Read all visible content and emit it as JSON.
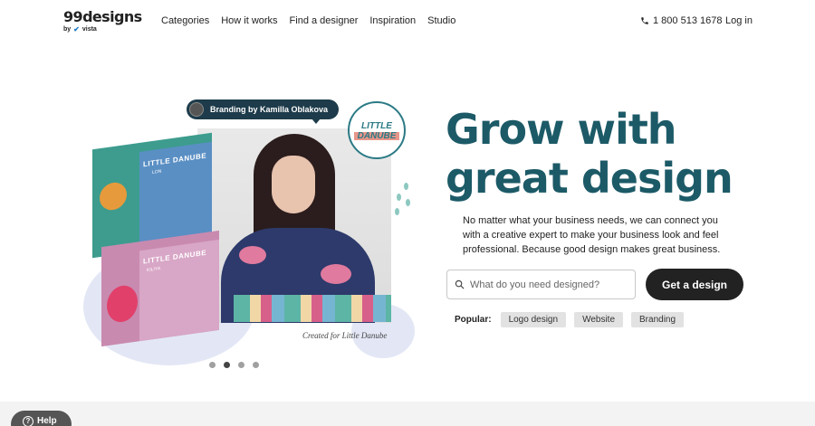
{
  "header": {
    "logo_main": "99designs",
    "logo_by": "by",
    "logo_brand": "vista",
    "nav": [
      "Categories",
      "How it works",
      "Find a designer",
      "Inspiration",
      "Studio"
    ],
    "phone": "1 800 513 1678",
    "login": "Log in"
  },
  "hero": {
    "credit": "Branding by Kamilla Oblakova",
    "badge_top": "LITTLE",
    "badge_bottom": "DANUBE",
    "box_top_label": "LITTLE DANUBE",
    "box_top_sub": "LON",
    "box_bottom_label": "LITTLE DANUBE",
    "box_bottom_sub": "KILIYA",
    "caption": "Created for Little Danube",
    "headline": "Grow with great design",
    "subcopy": "No matter what your business needs, we can connect you with a creative expert to make your business look and feel professional. Because good design makes great business.",
    "search_placeholder": "What do you need designed?",
    "cta": "Get a design",
    "popular_label": "Popular:",
    "popular": [
      "Logo design",
      "Website",
      "Branding"
    ],
    "carousel_active": 1
  },
  "help": {
    "label": "Help"
  },
  "colors": {
    "accent": "#1c5a67",
    "cta": "#222222"
  }
}
